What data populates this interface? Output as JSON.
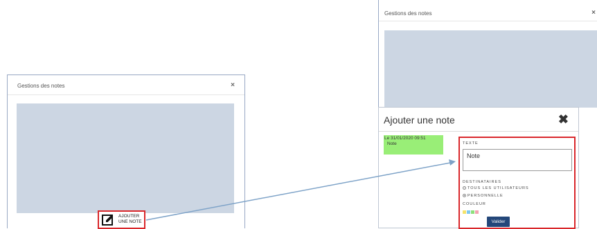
{
  "left_modal": {
    "title": "Gestions des notes",
    "close_glyph": "×",
    "add_button": {
      "line1": "AJOUTER",
      "line2": "UNE NOTE",
      "icon": "edit-icon"
    }
  },
  "right_modal": {
    "title": "Gestions des notes",
    "close_glyph": "×"
  },
  "dialog": {
    "title": "Ajouter une note",
    "close_glyph": "✖",
    "note": {
      "date": "Le 31/01/2020 09:51",
      "text": "Note"
    },
    "form": {
      "text_label": "TEXTE",
      "text_value": "Note",
      "recipients_label": "DESTINATAIRES",
      "option_all": "TOUS LES UTILISATEURS",
      "option_personal": "PERSONNELLE",
      "selected_option": "PERSONNELLE",
      "color_label": "COULEUR",
      "colors": [
        "#f5e36b",
        "#7ec8f0",
        "#8de07a",
        "#f2a3b3"
      ],
      "submit_label": "Valider"
    }
  },
  "colors": {
    "highlight": "#d9262a",
    "panel": "#ccd6e3",
    "note_bg": "#99ee77",
    "button": "#24477a",
    "arrow": "#7ea3c8"
  }
}
